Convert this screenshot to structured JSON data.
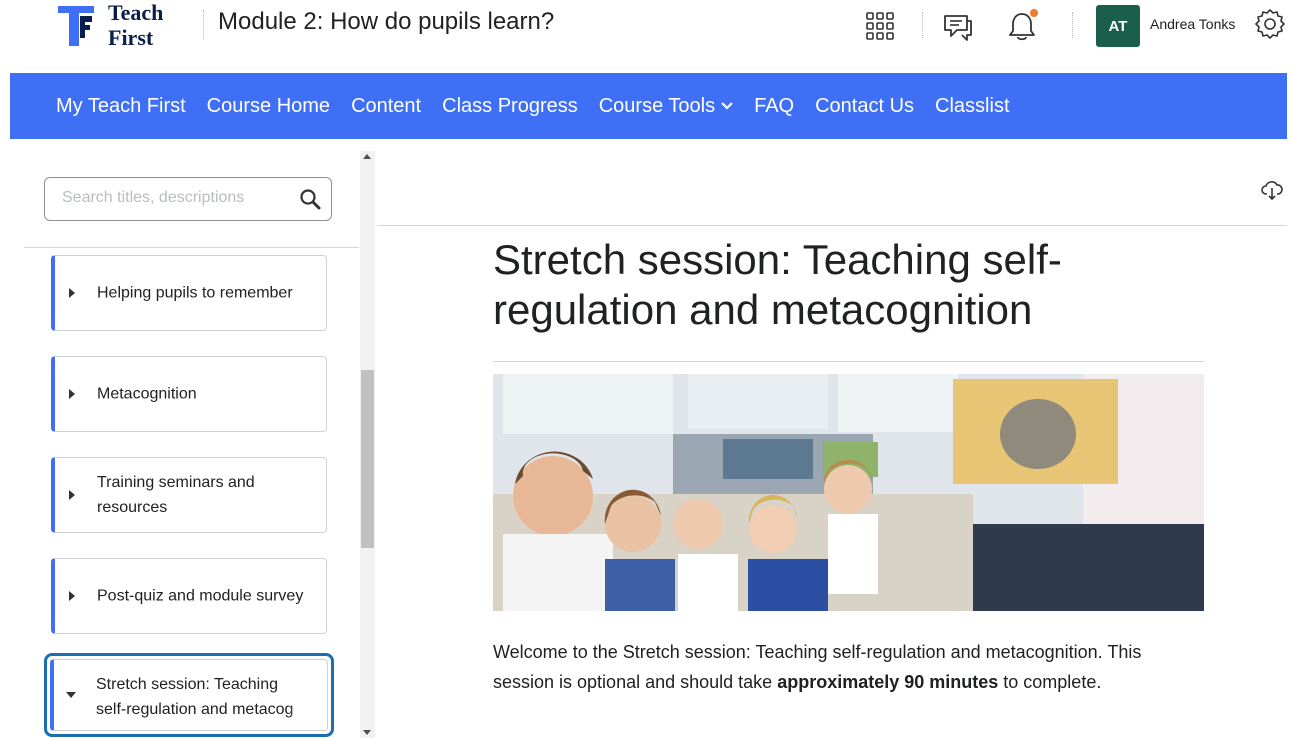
{
  "header": {
    "brand_line1": "Teach",
    "brand_line2": "First",
    "course_title": "Module 2: How do pupils learn?",
    "user": {
      "initials": "AT",
      "name": "Andrea Tonks"
    },
    "notification_dot_color": "#f07a2a",
    "icons": [
      "apps-grid-icon",
      "chat-icon",
      "bell-icon",
      "gear-icon"
    ]
  },
  "nav": {
    "color": "#3e6ff4",
    "items": [
      "My Teach First",
      "Course Home",
      "Content",
      "Class Progress",
      "Course Tools",
      "FAQ",
      "Contact Us",
      "Classlist"
    ]
  },
  "sidebar": {
    "search_placeholder": "Search titles, descriptions",
    "modules": [
      {
        "label": "Helping pupils to remember",
        "expanded": false
      },
      {
        "label": "Metacognition",
        "expanded": false
      },
      {
        "label": "Training seminars and resources",
        "expanded": false
      },
      {
        "label": "Post-quiz and module survey",
        "expanded": false
      },
      {
        "label_line1": "Stretch session: Teaching",
        "label_line2": "self-regulation and metacog",
        "expanded": true,
        "selected": true
      }
    ]
  },
  "main": {
    "title": "Stretch session: Teaching self-regulation and metacognition",
    "description_part1": "Welcome to the Stretch session: Teaching self-regulation and metacognition. This session is optional and should take ",
    "description_bold": "approximately 90 minutes",
    "description_part2": " to complete."
  }
}
